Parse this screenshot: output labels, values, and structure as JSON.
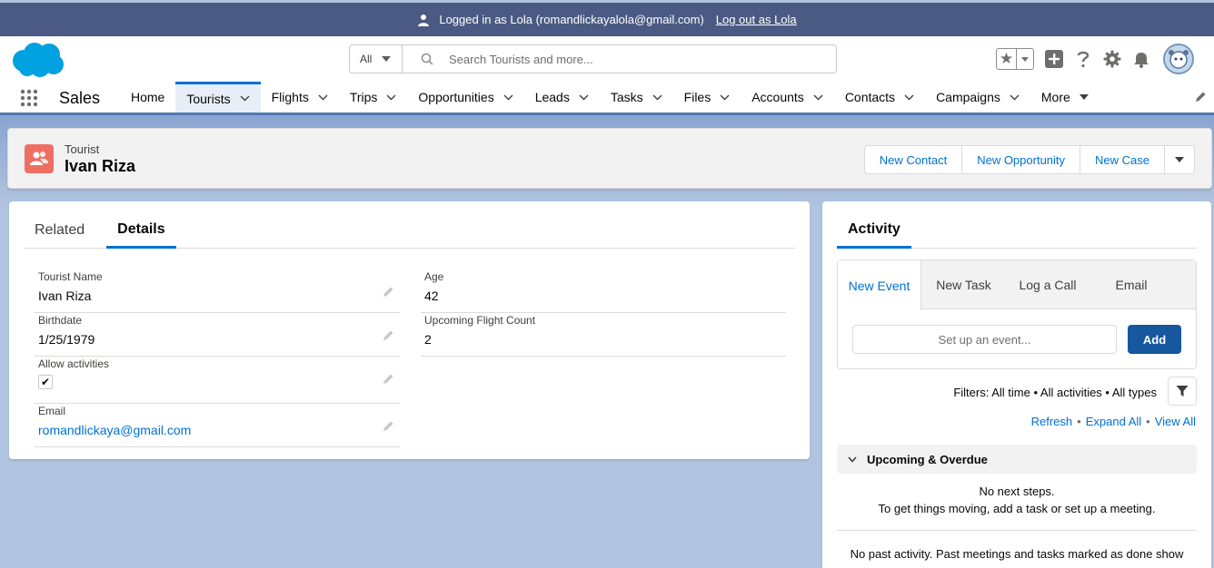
{
  "impersonation": {
    "logged_in_text": "Logged in as Lola (romandlickayalola@gmail.com)",
    "logout_link": "Log out as Lola"
  },
  "search": {
    "scope": "All",
    "placeholder": "Search Tourists and more..."
  },
  "app": {
    "name": "Sales"
  },
  "nav": {
    "items": [
      {
        "label": "Home",
        "chevron": false
      },
      {
        "label": "Tourists",
        "chevron": true,
        "active": true
      },
      {
        "label": "Flights",
        "chevron": true
      },
      {
        "label": "Trips",
        "chevron": true
      },
      {
        "label": "Opportunities",
        "chevron": true
      },
      {
        "label": "Leads",
        "chevron": true
      },
      {
        "label": "Tasks",
        "chevron": true
      },
      {
        "label": "Files",
        "chevron": true
      },
      {
        "label": "Accounts",
        "chevron": true
      },
      {
        "label": "Contacts",
        "chevron": true
      },
      {
        "label": "Campaigns",
        "chevron": true
      },
      {
        "label": "More",
        "chevron": true
      }
    ]
  },
  "record": {
    "object_type": "Tourist",
    "name": "Ivan Riza",
    "icon": "tourist-icon",
    "icon_color": "#ef6e64",
    "actions": [
      "New Contact",
      "New Opportunity",
      "New Case"
    ]
  },
  "details": {
    "tabs": [
      "Related",
      "Details"
    ],
    "active_tab": "Details",
    "fields": {
      "tourist_name": {
        "label": "Tourist Name",
        "value": "Ivan Riza"
      },
      "birthdate": {
        "label": "Birthdate",
        "value": "1/25/1979"
      },
      "allow_activities": {
        "label": "Allow activities",
        "value": "✔"
      },
      "email": {
        "label": "Email",
        "value": "romandlickaya@gmail.com"
      },
      "age": {
        "label": "Age",
        "value": "42"
      },
      "upcoming_flight_count": {
        "label": "Upcoming Flight Count",
        "value": "2"
      }
    }
  },
  "activity": {
    "title": "Activity",
    "composer_tabs": [
      "New Event",
      "New Task",
      "Log a Call",
      "Email"
    ],
    "event_placeholder": "Set up an event...",
    "add_label": "Add",
    "filters": "Filters: All time • All activities • All types",
    "links": {
      "refresh": "Refresh",
      "expand_all": "Expand All",
      "view_all": "View All",
      "separator": "•"
    },
    "upcoming_header": "Upcoming & Overdue",
    "no_steps_line1": "No next steps.",
    "no_steps_line2": "To get things moving, add a task or set up a meeting.",
    "no_past": "No past activity. Past meetings and tasks marked as done show"
  },
  "colors": {
    "brand_blue": "#0070d2",
    "impersonation_bar": "#4a5a82",
    "add_button": "#16579e",
    "logo": "#00a1e0"
  }
}
